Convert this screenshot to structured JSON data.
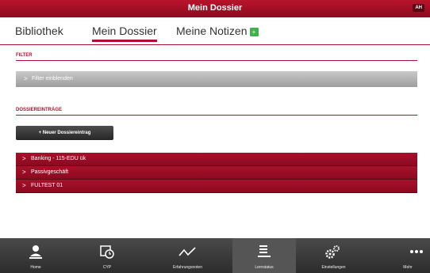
{
  "header": {
    "title": "Mein Dossier",
    "badge": "AH"
  },
  "tabs": [
    {
      "label": "Bibliothek"
    },
    {
      "label": "Mein Dossier",
      "active": true
    },
    {
      "label": "Meine Notizen"
    }
  ],
  "filter_section": {
    "label": "FILTER",
    "toggle_label": "Filter einblenden"
  },
  "dossier_section": {
    "label": "DOSSIEREINTRÄGE",
    "new_button": "+ Neuer Dossiereintrag"
  },
  "entries": [
    {
      "label": "Banking - 115-EDU ük"
    },
    {
      "label": "Passivgeschäft"
    },
    {
      "label": "FULTEST 01"
    }
  ],
  "bottom_nav": [
    {
      "label": "Home",
      "icon": "person-icon"
    },
    {
      "label": "CYP",
      "icon": "clock-icon"
    },
    {
      "label": "Erfahrungsnoten",
      "icon": "chart-line-icon"
    },
    {
      "label": "Lernstatus",
      "icon": "list-icon",
      "active": true
    },
    {
      "label": "Einstellungen",
      "icon": "gears-icon"
    },
    {
      "label": "Mehr",
      "icon": "more-icon"
    }
  ],
  "colors": {
    "brand": "#a3102a",
    "toolbar": "#333333",
    "filter": "#b0b0b0"
  }
}
